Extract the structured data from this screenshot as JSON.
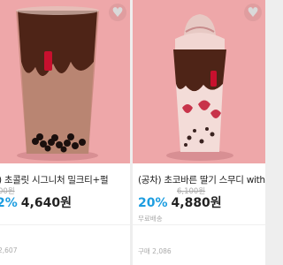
{
  "products": [
    {
      "title": ") 초콜릿 시그니처 밀크티+펄",
      "original_price": "00원",
      "discount": "2%",
      "price": "4,640원",
      "sold": "2,607"
    },
    {
      "title": "(공차) 초코바른 딸기 스무디 with 쿠키",
      "original_price": "6,100원",
      "discount": "20%",
      "price": "4,880원",
      "shipping": "무료배송",
      "sold": "구매 2,086"
    }
  ],
  "colors": {
    "accent": "#1d9de0",
    "image_bg": "#eea7a9"
  },
  "icons": {
    "favorite": "heart-icon"
  }
}
